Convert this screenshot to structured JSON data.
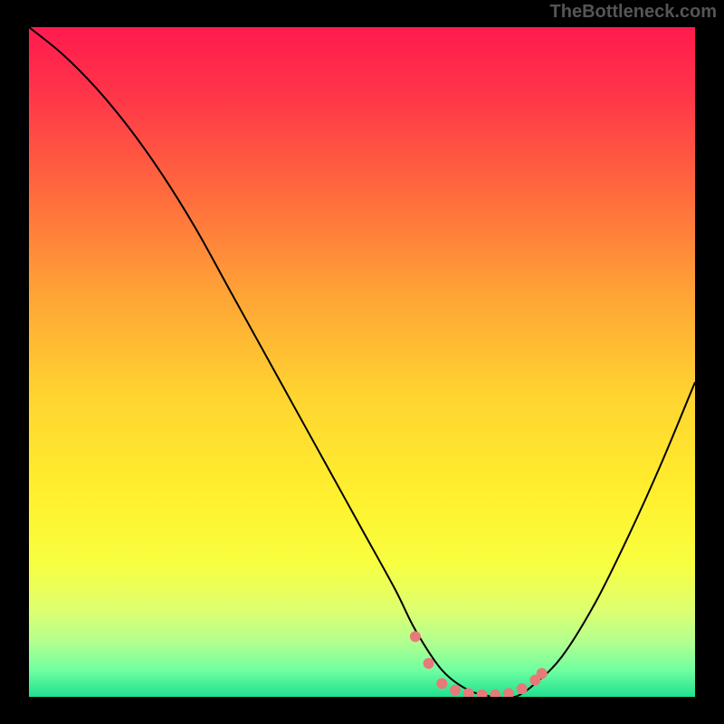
{
  "watermark": "TheBottleneck.com",
  "chart_data": {
    "type": "line",
    "title": "",
    "xlabel": "",
    "ylabel": "",
    "xlim": [
      0,
      100
    ],
    "ylim": [
      0,
      100
    ],
    "series": [
      {
        "name": "bottleneck-curve",
        "x": [
          0,
          5,
          10,
          15,
          20,
          25,
          30,
          35,
          40,
          45,
          50,
          55,
          58,
          62,
          66,
          70,
          73,
          76,
          80,
          85,
          90,
          95,
          100
        ],
        "y": [
          100,
          96,
          91,
          85,
          78,
          70,
          61,
          52,
          43,
          34,
          25,
          16,
          10,
          4,
          1,
          0,
          0,
          2,
          6,
          14,
          24,
          35,
          47
        ]
      }
    ],
    "markers": {
      "name": "highlight-points",
      "color": "#e67a78",
      "points": [
        {
          "x": 58,
          "y": 9
        },
        {
          "x": 60,
          "y": 5
        },
        {
          "x": 62,
          "y": 2
        },
        {
          "x": 64,
          "y": 1
        },
        {
          "x": 66,
          "y": 0.5
        },
        {
          "x": 68,
          "y": 0.3
        },
        {
          "x": 70,
          "y": 0.3
        },
        {
          "x": 72,
          "y": 0.5
        },
        {
          "x": 74,
          "y": 1.2
        },
        {
          "x": 76,
          "y": 2.5
        },
        {
          "x": 77,
          "y": 3.5
        }
      ]
    },
    "background_gradient": {
      "stops": [
        {
          "pos": 0.0,
          "color": "#ff1a4e"
        },
        {
          "pos": 0.1,
          "color": "#ff3549"
        },
        {
          "pos": 0.25,
          "color": "#ff6b3d"
        },
        {
          "pos": 0.4,
          "color": "#ffa436"
        },
        {
          "pos": 0.55,
          "color": "#ffd430"
        },
        {
          "pos": 0.7,
          "color": "#fff02e"
        },
        {
          "pos": 0.8,
          "color": "#f8ff40"
        },
        {
          "pos": 0.87,
          "color": "#deff70"
        },
        {
          "pos": 0.92,
          "color": "#b0ff90"
        },
        {
          "pos": 0.96,
          "color": "#70ffa0"
        },
        {
          "pos": 1.0,
          "color": "#20e090"
        }
      ]
    }
  }
}
